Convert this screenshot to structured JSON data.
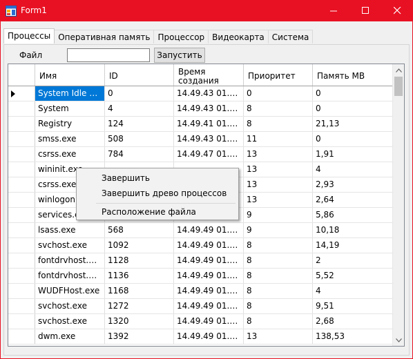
{
  "window": {
    "title": "Form1"
  },
  "colors": {
    "titlebar": "#e81123",
    "selection": "#0078d7"
  },
  "tabs": [
    {
      "label": "Процессы",
      "active": true
    },
    {
      "label": "Оперативная память",
      "active": false
    },
    {
      "label": "Процессор",
      "active": false
    },
    {
      "label": "Видеокарта",
      "active": false
    },
    {
      "label": "Система",
      "active": false
    }
  ],
  "toolbar": {
    "file_label": "Файл",
    "file_value": "",
    "run_label": "Запустить"
  },
  "grid": {
    "columns": [
      "Имя",
      "ID",
      "Время\nсоздания",
      "Приоритет",
      "Память МВ"
    ],
    "rows": [
      [
        "System Idle Proc...",
        "0",
        "14.49.43    01.04...",
        "0",
        "0"
      ],
      [
        "System",
        "4",
        "14.49.43    01.04...",
        "8",
        "0"
      ],
      [
        "Registry",
        "124",
        "14.49.41    01.04...",
        "8",
        "21,13"
      ],
      [
        "smss.exe",
        "508",
        "14.49.43    01.04...",
        "11",
        "0"
      ],
      [
        "csrss.exe",
        "784",
        "14.49.47    01.04...",
        "13",
        "1,91"
      ],
      [
        "wininit.exe",
        "",
        "",
        "13",
        "4"
      ],
      [
        "csrss.exe",
        "",
        "",
        "13",
        "2,93"
      ],
      [
        "winlogon.exe",
        "",
        "",
        "13",
        "2,64"
      ],
      [
        "services.exe",
        "",
        "",
        "9",
        "5,86"
      ],
      [
        "lsass.exe",
        "568",
        "14.49.49    01.04...",
        "9",
        "10,18"
      ],
      [
        "svchost.exe",
        "1092",
        "14.49.49    01.04...",
        "8",
        "14,19"
      ],
      [
        "fontdrvhost.exe",
        "1128",
        "14.49.49    01.04...",
        "8",
        "2"
      ],
      [
        "fontdrvhost.exe",
        "1136",
        "14.49.49    01.04...",
        "8",
        "5,52"
      ],
      [
        "WUDFHost.exe",
        "1168",
        "14.49.49    01.04...",
        "8",
        "4"
      ],
      [
        "svchost.exe",
        "1272",
        "14.49.49    01.04...",
        "8",
        "9,51"
      ],
      [
        "svchost.exe",
        "1320",
        "14.49.49    01.04...",
        "8",
        "2,68"
      ],
      [
        "dwm.exe",
        "1392",
        "14.49.49    01.04...",
        "13",
        "138,53"
      ]
    ]
  },
  "context_menu": {
    "items": [
      "Завершить",
      "Завершить древо процессов",
      "Расположение файла"
    ]
  }
}
